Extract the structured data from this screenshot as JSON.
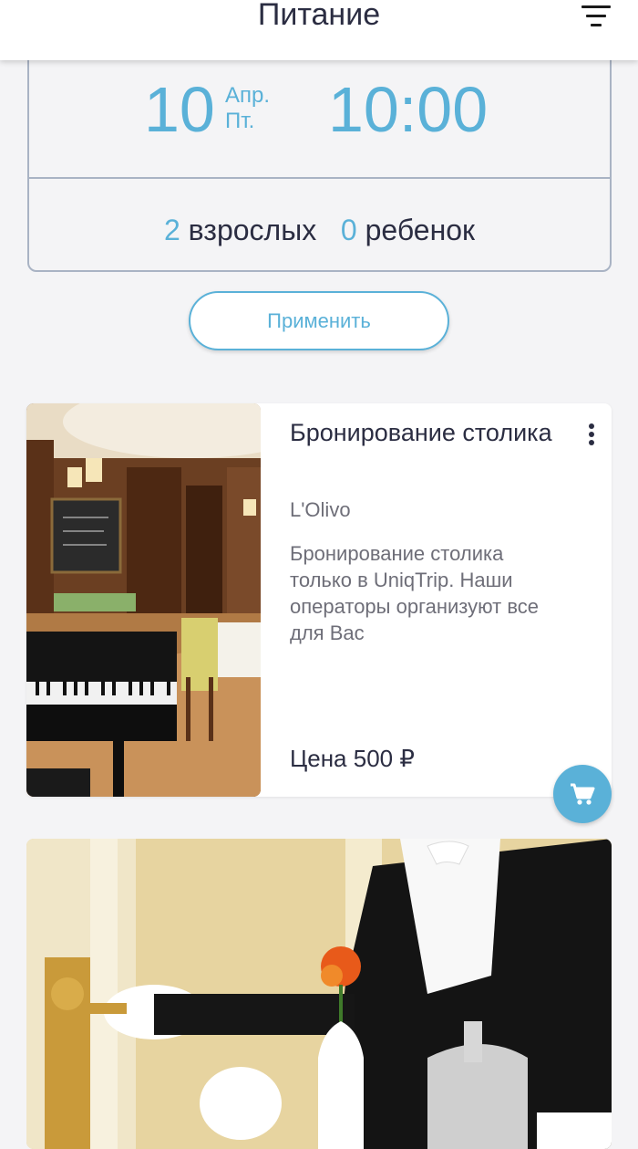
{
  "header": {
    "title": "Питание"
  },
  "booking": {
    "date_day": "10",
    "date_month": "Апр.",
    "date_weekday": "Пт.",
    "time": "10:00",
    "adults_count": "2",
    "adults_label": "взрослых",
    "children_count": "0",
    "children_label": "ребенок"
  },
  "apply_label": "Применить",
  "offers": [
    {
      "title": "Бронирование столика",
      "venue": "L'Olivo",
      "description": "Бронирование столика только в UniqTrip. Наши операторы организуют все для Вас",
      "price": "Цена 500 ₽"
    }
  ],
  "colors": {
    "accent": "#5ab1d8",
    "text": "#2b2d42",
    "muted": "#6e6e78",
    "border": "#a9b3c4"
  },
  "icons": [
    "filter-icon",
    "more-vertical-icon",
    "cart-icon"
  ]
}
